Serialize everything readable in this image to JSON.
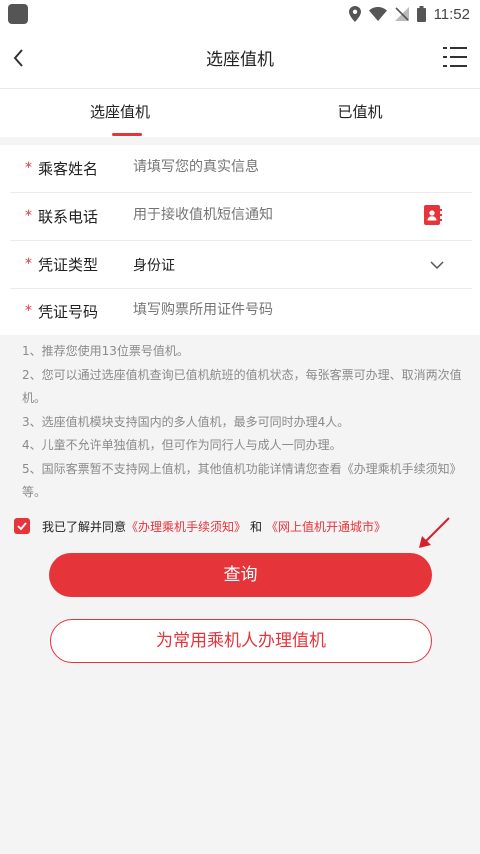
{
  "status_bar": {
    "time": "11:52"
  },
  "header": {
    "title": "选座值机"
  },
  "tabs": [
    {
      "label": "选座值机"
    },
    {
      "label": "已值机"
    }
  ],
  "form": {
    "rows": [
      {
        "label": "乘客姓名",
        "placeholder": "请填写您的真实信息"
      },
      {
        "label": "联系电话",
        "placeholder": "用于接收值机短信通知"
      },
      {
        "label": "凭证类型",
        "value": "身份证"
      },
      {
        "label": "凭证号码",
        "placeholder": "填写购票所用证件号码"
      }
    ],
    "required_mark": "*"
  },
  "notes": [
    "1、推荐您使用13位票号值机。",
    "2、您可以通过选座值机查询已值机航班的值机状态，每张客票可办理、取消两次值机。",
    "3、选座值机模块支持国内的多人值机，最多可同时办理4人。",
    "4、儿童不允许单独值机，但可作为同行人与成人一同办理。",
    "5、国际客票暂不支持网上值机，其他值机功能详情请您查看《办理乘机手续须知》等。"
  ],
  "agreement": {
    "text": "我已了解并同意",
    "link1": "《办理乘机手续须知》",
    "conjunction": "和",
    "link2": "《网上值机开通城市》",
    "checked": true
  },
  "buttons": {
    "primary": "查询",
    "secondary": "为常用乘机人办理值机"
  },
  "colors": {
    "accent": "#e6343b"
  }
}
